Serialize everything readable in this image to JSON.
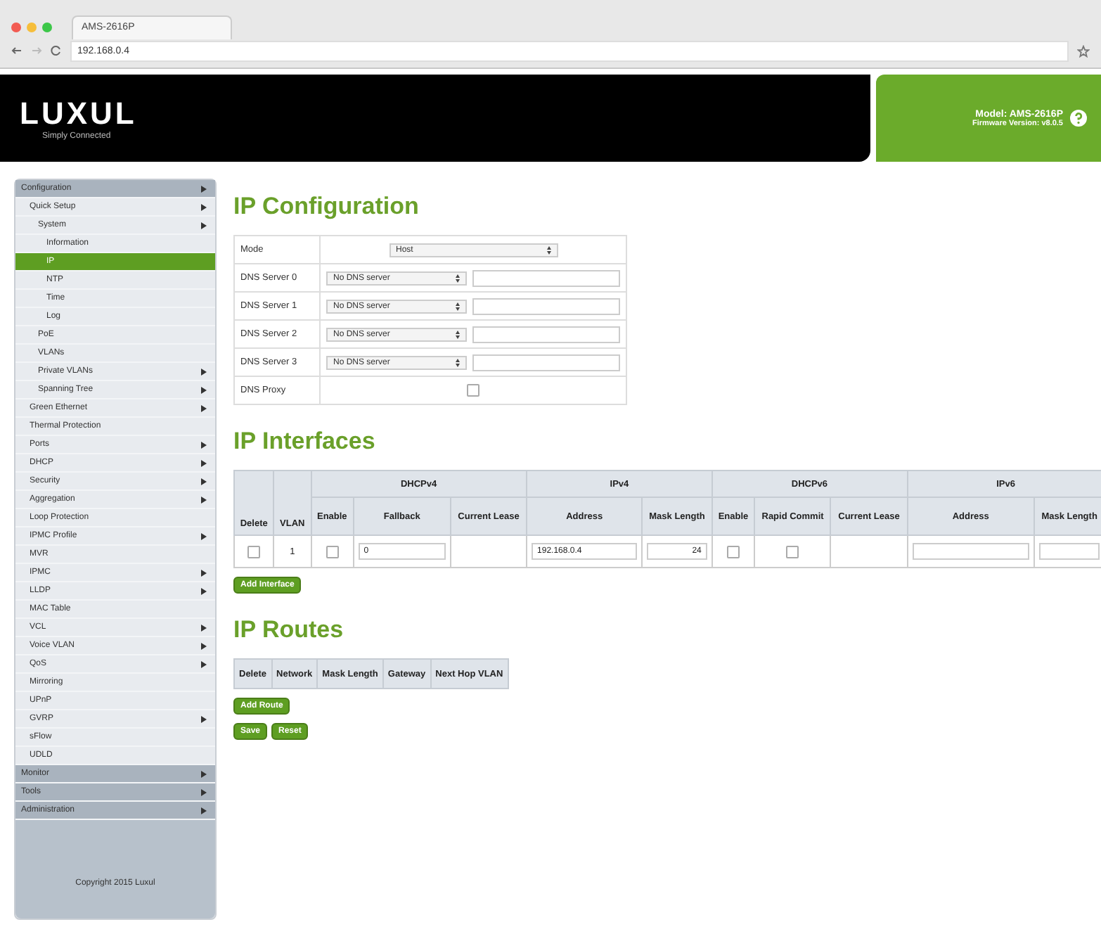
{
  "browser": {
    "tab_title": "AMS-2616P",
    "url": "192.168.0.4"
  },
  "header": {
    "logo": "LUXUL",
    "tagline": "Simply Connected",
    "model": "Model: AMS-2616P",
    "firmware": "Firmware Version: v8.0.5"
  },
  "sidebar": {
    "items": [
      {
        "label": "Configuration",
        "submenu": true,
        "selected": false,
        "children": [
          {
            "label": "Quick Setup",
            "submenu": true,
            "selected": false,
            "children": [
              {
                "label": "System",
                "submenu": true,
                "selected": false,
                "children": [
                  {
                    "label": "Information",
                    "submenu": false,
                    "selected": false
                  },
                  {
                    "label": "IP",
                    "submenu": false,
                    "selected": true
                  },
                  {
                    "label": "NTP",
                    "submenu": false,
                    "selected": false
                  },
                  {
                    "label": "Time",
                    "submenu": false,
                    "selected": false
                  },
                  {
                    "label": "Log",
                    "submenu": false,
                    "selected": false
                  }
                ]
              },
              {
                "label": "PoE",
                "submenu": false,
                "selected": false
              },
              {
                "label": "VLANs",
                "submenu": false,
                "selected": false
              },
              {
                "label": "Private VLANs",
                "submenu": true,
                "selected": false
              },
              {
                "label": "Spanning Tree",
                "submenu": true,
                "selected": false
              }
            ]
          },
          {
            "label": "Green Ethernet",
            "submenu": true,
            "selected": false
          },
          {
            "label": "Thermal Protection",
            "submenu": false,
            "selected": false
          },
          {
            "label": "Ports",
            "submenu": true,
            "selected": false
          },
          {
            "label": "DHCP",
            "submenu": true,
            "selected": false
          },
          {
            "label": "Security",
            "submenu": true,
            "selected": false
          },
          {
            "label": "Aggregation",
            "submenu": true,
            "selected": false
          },
          {
            "label": "Loop Protection",
            "submenu": false,
            "selected": false
          },
          {
            "label": "IPMC Profile",
            "submenu": true,
            "selected": false
          },
          {
            "label": "MVR",
            "submenu": false,
            "selected": false
          },
          {
            "label": "IPMC",
            "submenu": true,
            "selected": false
          },
          {
            "label": "LLDP",
            "submenu": true,
            "selected": false
          },
          {
            "label": "MAC Table",
            "submenu": false,
            "selected": false
          },
          {
            "label": "VCL",
            "submenu": true,
            "selected": false
          },
          {
            "label": "Voice VLAN",
            "submenu": true,
            "selected": false
          },
          {
            "label": "QoS",
            "submenu": true,
            "selected": false
          },
          {
            "label": "Mirroring",
            "submenu": false,
            "selected": false
          },
          {
            "label": "UPnP",
            "submenu": false,
            "selected": false
          },
          {
            "label": "GVRP",
            "submenu": true,
            "selected": false
          },
          {
            "label": "sFlow",
            "submenu": false,
            "selected": false
          },
          {
            "label": "UDLD",
            "submenu": false,
            "selected": false
          }
        ]
      },
      {
        "label": "Monitor",
        "submenu": true,
        "selected": false
      },
      {
        "label": "Tools",
        "submenu": true,
        "selected": false
      },
      {
        "label": "Administration",
        "submenu": true,
        "selected": false
      }
    ],
    "copyright": "Copyright 2015 Luxul"
  },
  "ip_configuration": {
    "title": "IP Configuration",
    "rows": [
      {
        "kind": "select",
        "label": "Mode",
        "value": "Host"
      },
      {
        "kind": "dns",
        "label": "DNS Server 0",
        "value": "No DNS server"
      },
      {
        "kind": "dns",
        "label": "DNS Server 1",
        "value": "No DNS server"
      },
      {
        "kind": "dns",
        "label": "DNS Server 2",
        "value": "No DNS server"
      },
      {
        "kind": "dns",
        "label": "DNS Server 3",
        "value": "No DNS server"
      },
      {
        "kind": "checkbox",
        "label": "DNS Proxy",
        "checked": false
      }
    ]
  },
  "ip_interfaces": {
    "title": "IP Interfaces",
    "columns": [
      "Delete",
      "VLAN"
    ],
    "groups": [
      {
        "label": "DHCPv4",
        "columns": [
          "Enable",
          "Fallback",
          "Current Lease"
        ]
      },
      {
        "label": "IPv4",
        "columns": [
          "Address",
          "Mask Length"
        ]
      },
      {
        "label": "DHCPv6",
        "columns": [
          "Enable",
          "Rapid Commit",
          "Current Lease"
        ]
      },
      {
        "label": "IPv6",
        "columns": [
          "Address",
          "Mask Length"
        ]
      }
    ],
    "rows": [
      {
        "delete": false,
        "vlan": "1",
        "dhcp4_enable": false,
        "fallback": "0",
        "address4": "192.168.0.4",
        "mask4": "24",
        "dhcp6_enable": false,
        "rapid_commit": false
      }
    ],
    "add_button": "Add Interface"
  },
  "ip_routes": {
    "title": "IP Routes",
    "columns": [
      "Delete",
      "Network",
      "Mask Length",
      "Gateway",
      "Next Hop VLAN"
    ],
    "add_button": "Add Route"
  },
  "buttons": [
    "Save",
    "Reset"
  ]
}
